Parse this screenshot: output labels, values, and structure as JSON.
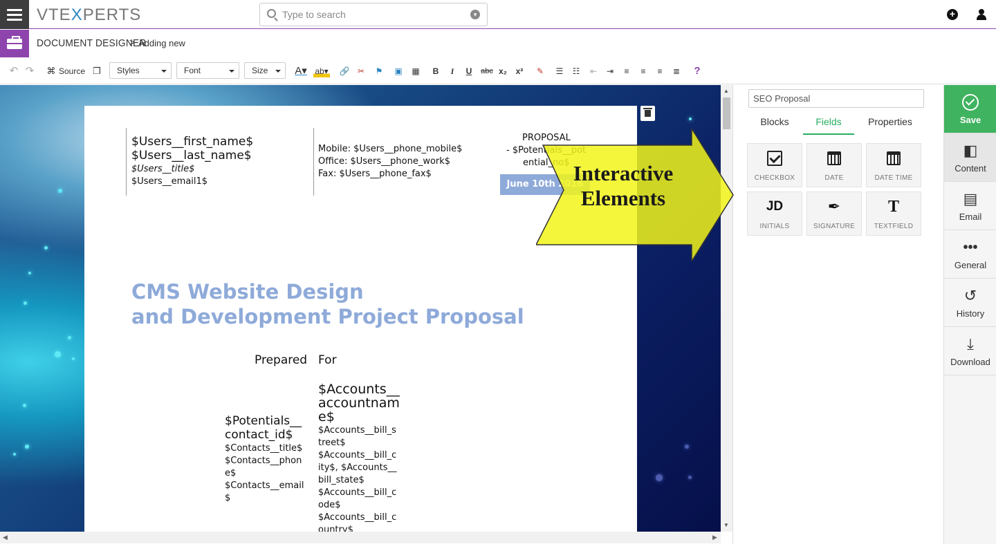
{
  "app": {
    "logo_left": "VTE",
    "logo_x": "X",
    "logo_right": "PERTS"
  },
  "search": {
    "placeholder": "Type to search"
  },
  "breadcrumb": {
    "module": "DOCUMENT DESIGNER",
    "separator": ">",
    "page": "Adding new"
  },
  "toolbar": {
    "source_label": "Source",
    "styles_label": "Styles",
    "font_label": "Font",
    "size_label": "Size",
    "bold": "B",
    "italic": "I",
    "underline": "U",
    "strike": "abc",
    "subscript": "x₂",
    "superscript": "x²",
    "help": "?"
  },
  "document": {
    "user_name": "$Users__first_name$",
    "user_last": "$Users__last_name$",
    "user_title": "$Users__title$",
    "user_email": "$Users__email1$",
    "mobile": "Mobile: $Users__phone_mobile$",
    "office": "Office: $Users__phone_work$",
    "fax": "Fax: $Users__phone_fax$",
    "proposal_label": "PROPOSAL",
    "proposal_no_1": "- $Potentials__pot",
    "proposal_no_2": "ential_no$",
    "date_badge": "June 10th 2016",
    "title_line1": "CMS Website Design",
    "title_line2": "and Development Project Proposal",
    "prepared": "Prepared",
    "for": "For",
    "account_name_1": "$Accounts__",
    "account_name_2": "accountnam",
    "account_name_3": "e$",
    "contact_1": "$Potentials__",
    "contact_2": "contact_id$",
    "contacts_lines": [
      "$Contacts__title$",
      "$Contacts__phon",
      "e$",
      "$Contacts__email",
      "$"
    ],
    "account_lines": [
      "$Accounts__bill_s",
      "treet$",
      "$Accounts__bill_c",
      "ity$, $Accounts__",
      "bill_state$",
      "$Accounts__bill_c",
      "ode$",
      "$Accounts__bill_c",
      "ountry$"
    ]
  },
  "callout": {
    "line1": "Interactive",
    "line2": "Elements",
    "color": "#f2f51a"
  },
  "panel": {
    "doc_name": "SEO Proposal",
    "tabs": [
      "Blocks",
      "Fields",
      "Properties"
    ],
    "active_tab": "Fields",
    "fields": [
      "CHECKBOX",
      "DATE",
      "DATE TIME",
      "INITIALS",
      "SIGNATURE",
      "TEXTFIELD"
    ],
    "initials_glyph": "JD",
    "textfield_glyph": "T"
  },
  "sidebar": {
    "items": [
      "Save",
      "Content",
      "Email",
      "General",
      "History",
      "Download"
    ],
    "save_color": "#3fb35f"
  },
  "colors": {
    "accent_purple": "#8e44ad",
    "title_blue": "#8eaad9",
    "active_green": "#27ae60"
  }
}
